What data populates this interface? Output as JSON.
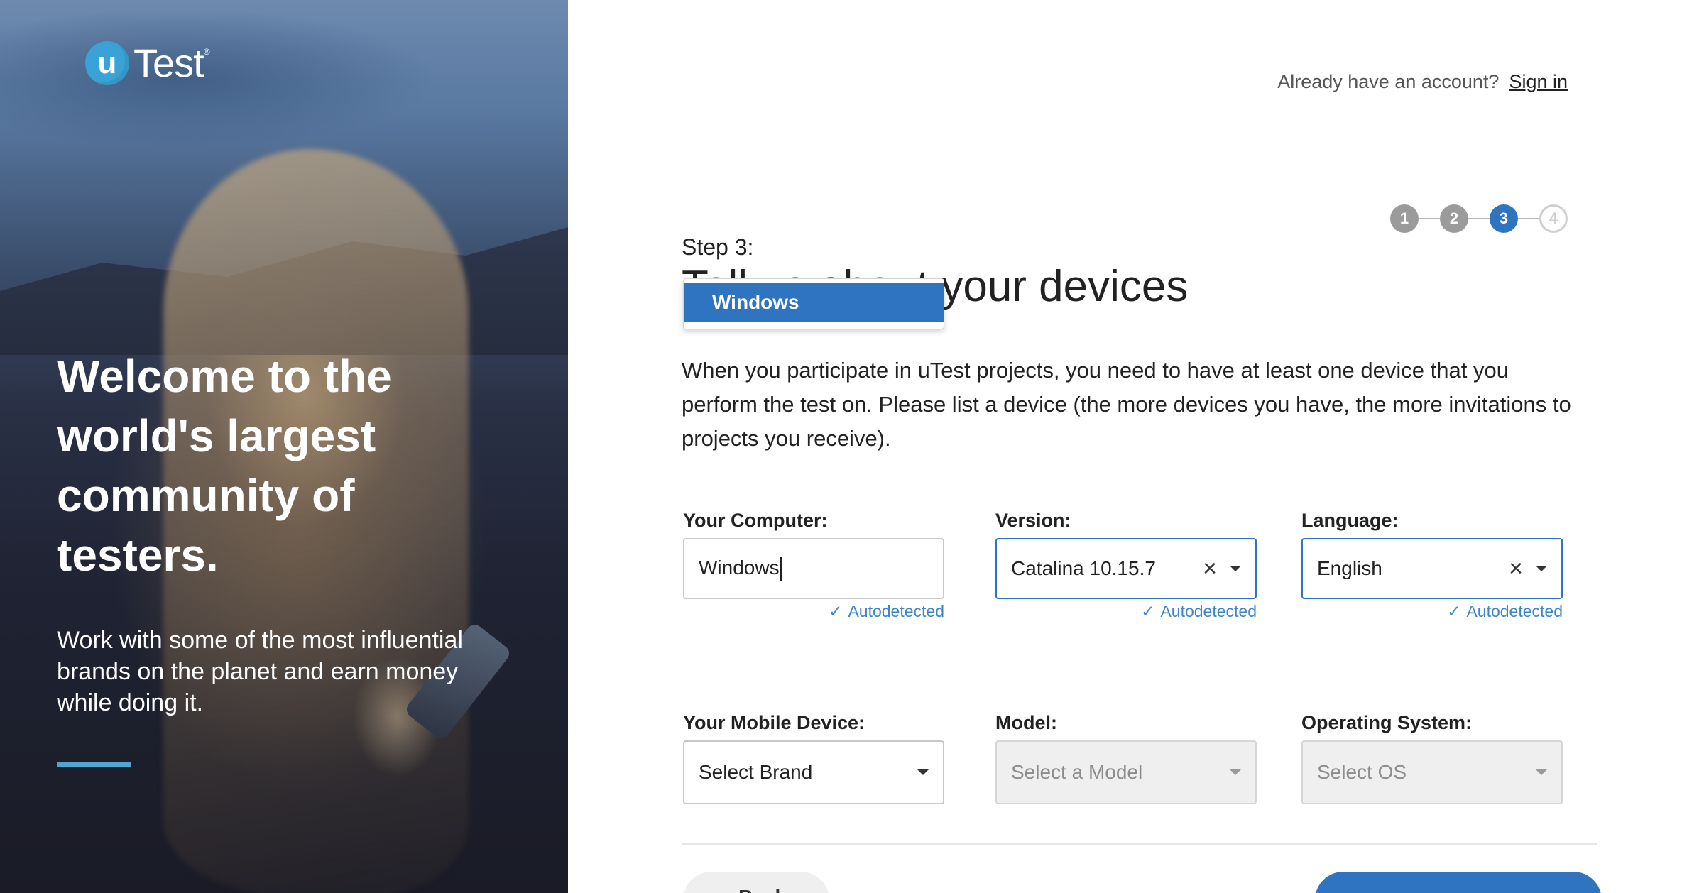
{
  "brand": {
    "logo_letter": "u",
    "logo_word": "Test",
    "logo_reg": "®",
    "accent": "#2f74c0",
    "logo_color": "#3aa2d6"
  },
  "hero": {
    "title": "Welcome to the world's largest community of testers.",
    "subtitle": "Work with some of the most influential brands on the planet and earn money while doing it."
  },
  "header": {
    "account_prompt": "Already have an account?",
    "signin_label": "Sign in"
  },
  "steps": [
    {
      "label": "1",
      "state": "done"
    },
    {
      "label": "2",
      "state": "done"
    },
    {
      "label": "3",
      "state": "active"
    },
    {
      "label": "4",
      "state": "todo"
    }
  ],
  "main": {
    "step_label": "Step 3:",
    "title": "Tell us about your devices",
    "intro": "When you participate in uTest projects, you need to have at least one device that you perform the test on. Please list a device (the more devices you have, the more invitations to projects you receive)."
  },
  "dropdown": {
    "options": [
      "Windows"
    ],
    "highlighted": "Windows"
  },
  "computer": {
    "label": "Your Computer:",
    "value": "Windows",
    "autodetected": "Autodetected"
  },
  "version": {
    "label": "Version:",
    "value": "Catalina 10.15.7",
    "autodetected": "Autodetected"
  },
  "language": {
    "label": "Language:",
    "value": "English",
    "autodetected": "Autodetected"
  },
  "mobile": {
    "label": "Your Mobile Device:",
    "placeholder": "Select Brand"
  },
  "model": {
    "label": "Model:",
    "placeholder": "Select a Model"
  },
  "os": {
    "label": "Operating System:",
    "placeholder": "Select OS"
  },
  "footer": {
    "back_label": "‹ Back"
  }
}
